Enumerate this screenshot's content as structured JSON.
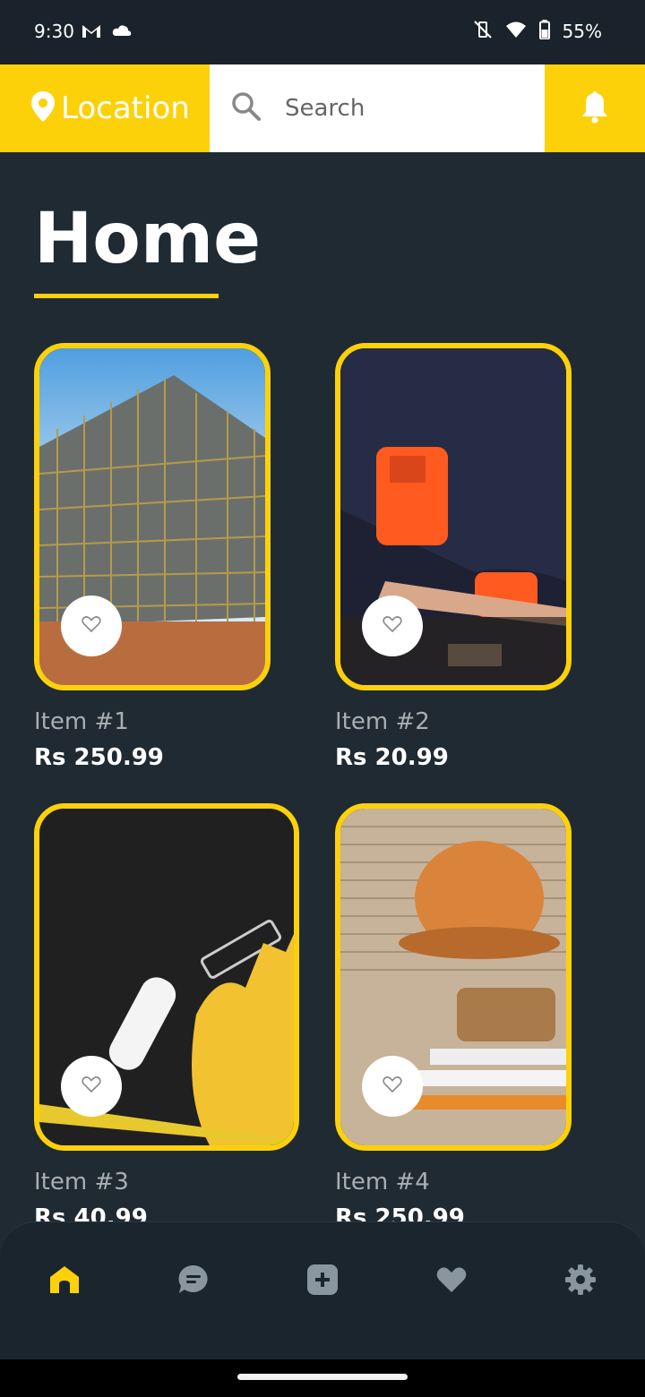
{
  "status_bar": {
    "time": "9:30",
    "battery": "55%",
    "left_icons": [
      "gmail-icon",
      "cloud-icon"
    ],
    "right_icons": [
      "mute-vibrate-icon",
      "wifi-icon",
      "battery-icon"
    ]
  },
  "top_bar": {
    "location_label": "Location",
    "search_placeholder": "Search",
    "notification_icon": "bell-icon"
  },
  "page": {
    "title": "Home"
  },
  "items": [
    {
      "name": "Item #1",
      "price": "Rs 250.99"
    },
    {
      "name": "Item #2",
      "price": "Rs 20.99"
    },
    {
      "name": "Item #3",
      "price": "Rs 40.99"
    },
    {
      "name": "Item #4",
      "price": "Rs 250.99"
    }
  ],
  "bottom_nav": {
    "items": [
      {
        "icon": "home-icon",
        "active": true
      },
      {
        "icon": "chat-icon",
        "active": false
      },
      {
        "icon": "add-icon",
        "active": false
      },
      {
        "icon": "heart-icon",
        "active": false
      },
      {
        "icon": "settings-icon",
        "active": false
      }
    ]
  },
  "colors": {
    "accent": "#fdd10a",
    "background": "#1f2a32",
    "muted_text": "#a9afb3",
    "inactive_icon": "#8a969f"
  }
}
